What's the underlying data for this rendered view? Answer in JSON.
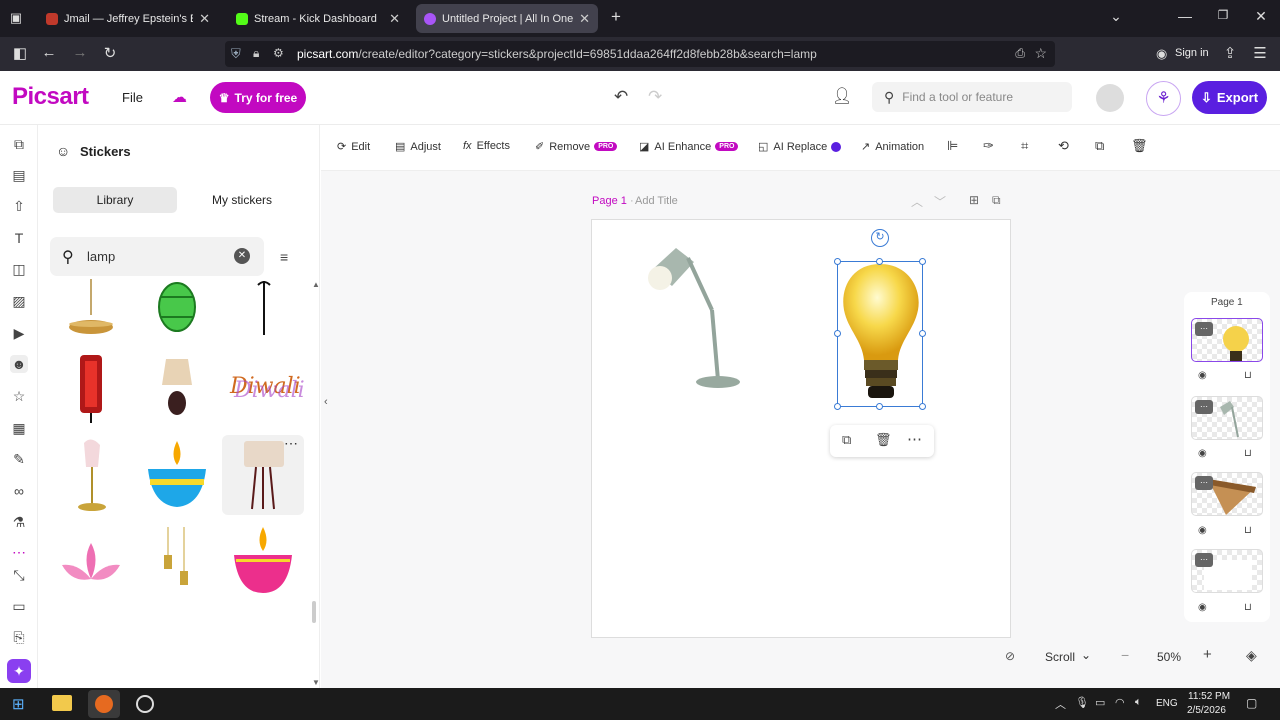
{
  "browser": {
    "tabs": [
      {
        "title": "Jmail — Jeffrey Epstein's Emails",
        "favicon_color": "#c0392b"
      },
      {
        "title": "Stream - Kick Dashboard",
        "favicon_color": "#53fc18"
      },
      {
        "title": "Untitled Project | All In One We",
        "favicon_color": "#a855f7"
      }
    ],
    "url_domain": "picsart.com",
    "url_path": "/create/editor?category=stickers&projectId=69851ddaa264ff2d8febb28b&search=lamp",
    "signin_label": "Sign in"
  },
  "header": {
    "logo": "Picsart",
    "file_label": "File",
    "try_label": "Try for free",
    "search_placeholder": "Find a tool or feature",
    "export_label": "Export"
  },
  "panel": {
    "title": "Stickers",
    "tab_library": "Library",
    "tab_my": "My stickers",
    "search_value": "lamp"
  },
  "toolbar": {
    "edit": "Edit",
    "adjust": "Adjust",
    "effects": "Effects",
    "remove": "Remove",
    "ai_enhance": "AI Enhance",
    "ai_replace": "AI Replace",
    "animation": "Animation",
    "pro": "PRO"
  },
  "canvas": {
    "page_label": "Page 1",
    "add_title": "Add Title"
  },
  "layers": {
    "title": "Page 1"
  },
  "bottom": {
    "scroll_label": "Scroll",
    "zoom": "50%"
  },
  "taskbar": {
    "lang": "ENG",
    "time": "11:52 PM",
    "date": "2/5/2026"
  },
  "colors": {
    "brand": "#c209c1",
    "export": "#5a1fe0",
    "selection": "#3a7bd5"
  }
}
